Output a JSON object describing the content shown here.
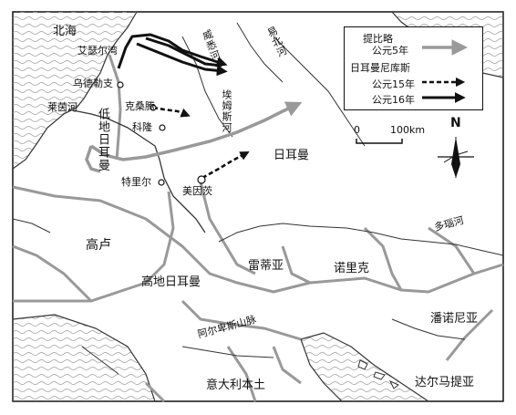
{
  "legend": {
    "title": "提比略",
    "item1": "公元5年",
    "item2": "日耳曼尼库斯",
    "item3": "公元15年",
    "item4": "公元16年",
    "colors": {
      "route5": "#999999",
      "route15": "#111111",
      "route16": "#111111"
    }
  },
  "scale": {
    "start": "0",
    "end": "100km"
  },
  "north": "N",
  "labels": {
    "north_sea": "北海",
    "ijsselmeer": "艾瑟尔湾",
    "utrecht": "乌德勒支",
    "rhine_river": "莱茵河",
    "low_germany": "低地日耳曼",
    "xanten": "克桑腾",
    "cologne": "科隆",
    "trier": "特里尔",
    "mainz": "美因茨",
    "weser": "威悉河",
    "elbe": "易北河",
    "lippe": "埃姆斯河",
    "germania": "日耳曼",
    "gaul": "高卢",
    "upper_germany": "高地日耳曼",
    "raetia": "雷蒂亚",
    "noricum": "诺里克",
    "danube": "多瑙河",
    "pannonia": "潘诺尼亚",
    "alps": "阿尔卑斯山脉",
    "italy": "意大利本土",
    "dalmatia": "达尔马提亚"
  }
}
